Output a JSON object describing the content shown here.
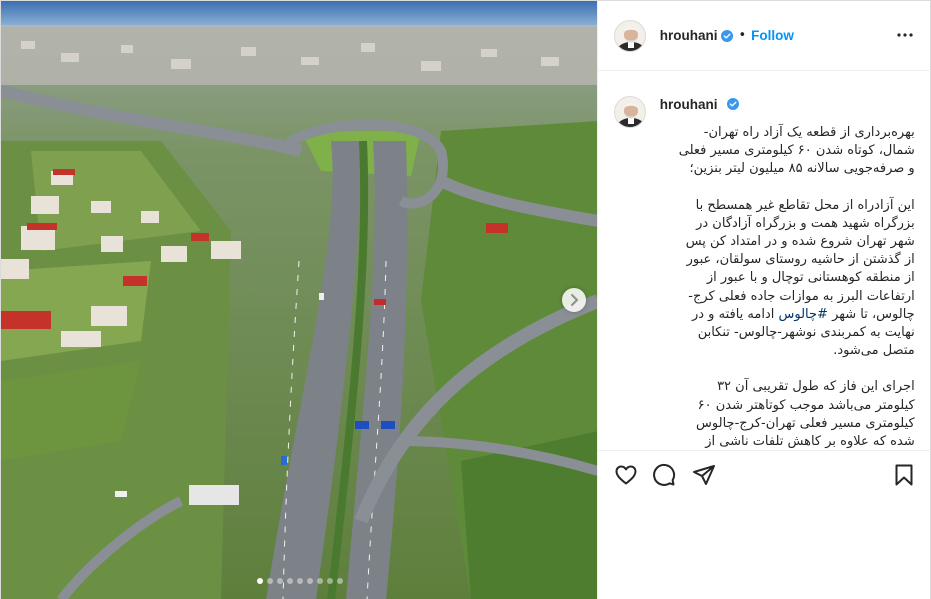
{
  "header": {
    "username": "hrouhani",
    "separator": "•",
    "follow_label": "Follow",
    "more_icon": "more-horizontal-icon"
  },
  "caption": {
    "username": "hrouhani",
    "paragraphs": [
      "بهره‌برداری از قطعه یک آزاد راه تهران- شمال، کوتاه شدن ۶۰ کیلومتری مسیر فعلی و صرفه‌جویی سالانه ۸۵ میلیون لیتر بنزین؛",
      "این آزادراه از محل تقاطع غیر همسطح با بزرگراه شهید همت و بزرگراه آزادگان در شهر تهران شروع شده و در امتداد کن پس از گذشتن از حاشیه روستای سولقان، عبور از منطقه کوهستانی توچال و با عبور از ارتفاعات البرز به موازات جاده فعلی کرج- چالوس، تا شهر",
      "ادامه یافته و در نهایت به کمربندی نوشهر-چالوس- تنکابن متصل می‌شود.",
      "اجرای این فاز که طول تقریبی آن ۳۲ کیلومتر می‌باشد موجب کوتاهتر شدن ۶۰ کیلومتری مسیر فعلی تهران-کرج-چالوس شده که علاوه بر کاهش تلفات ناشی از"
    ],
    "hashtag": "#چالوس"
  },
  "actions": {
    "like_icon": "heart-icon",
    "comment_icon": "comment-icon",
    "share_icon": "share-icon",
    "save_icon": "bookmark-icon"
  },
  "carousel": {
    "slide_count": 9,
    "active_index": 0
  },
  "colors": {
    "link_blue": "#0095f6",
    "hashtag": "#00376b",
    "verified": "#3897f0"
  }
}
